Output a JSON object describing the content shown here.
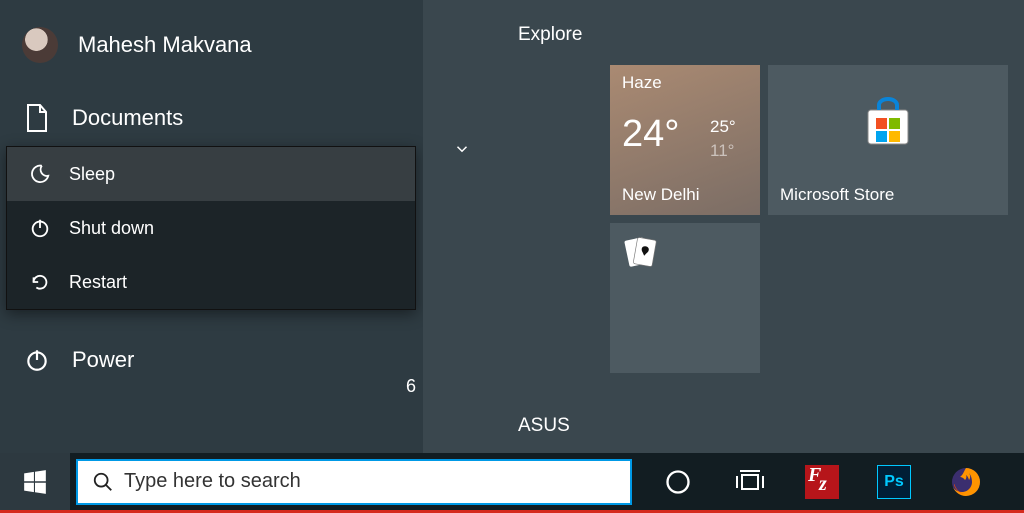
{
  "user": {
    "name": "Mahesh Makvana"
  },
  "sidebar": {
    "documents_label": "Documents",
    "power_label": "Power"
  },
  "power_menu": {
    "sleep": "Sleep",
    "shutdown": "Shut down",
    "restart": "Restart"
  },
  "digit_artifact": "6",
  "tiles": {
    "group_explore": "Explore",
    "group_asus": "ASUS",
    "weather": {
      "condition": "Haze",
      "temp": "24°",
      "high": "25°",
      "low": "11°",
      "city": "New Delhi"
    },
    "store": {
      "label": "Microsoft Store"
    }
  },
  "search": {
    "placeholder": "Type here to search"
  },
  "taskbar_icons": {
    "cortana": "cortana-ring-icon",
    "taskview": "task-view-icon",
    "filezilla": "Fz",
    "photoshop": "Ps",
    "firefox": "firefox-icon"
  }
}
